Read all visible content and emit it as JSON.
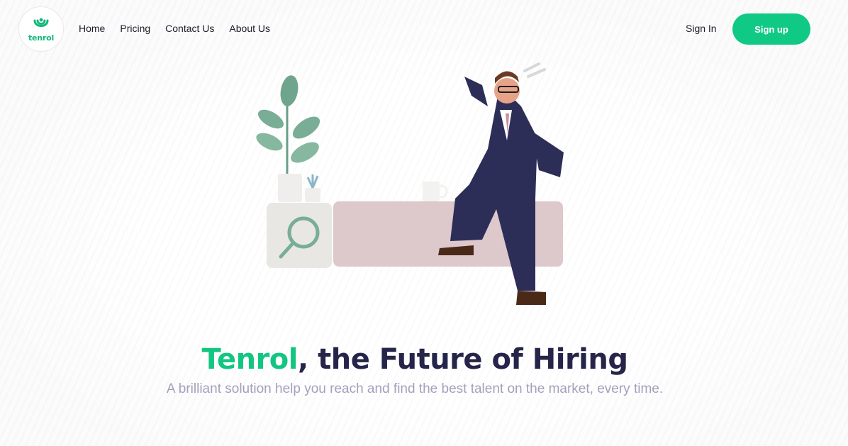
{
  "header": {
    "logo_text": "tenrol",
    "nav": [
      {
        "label": "Home"
      },
      {
        "label": "Pricing"
      },
      {
        "label": "Contact Us"
      },
      {
        "label": "About Us"
      }
    ],
    "sign_in": "Sign In",
    "sign_up": "Sign up"
  },
  "hero": {
    "brand": "Tenrol",
    "headline_rest": ", the Future of Hiring",
    "subheadline": "A brilliant solution help you reach and find the best talent on the market, every time."
  },
  "colors": {
    "accent": "#10c985",
    "heading": "#25254a",
    "subtext": "#a3a0bd"
  }
}
